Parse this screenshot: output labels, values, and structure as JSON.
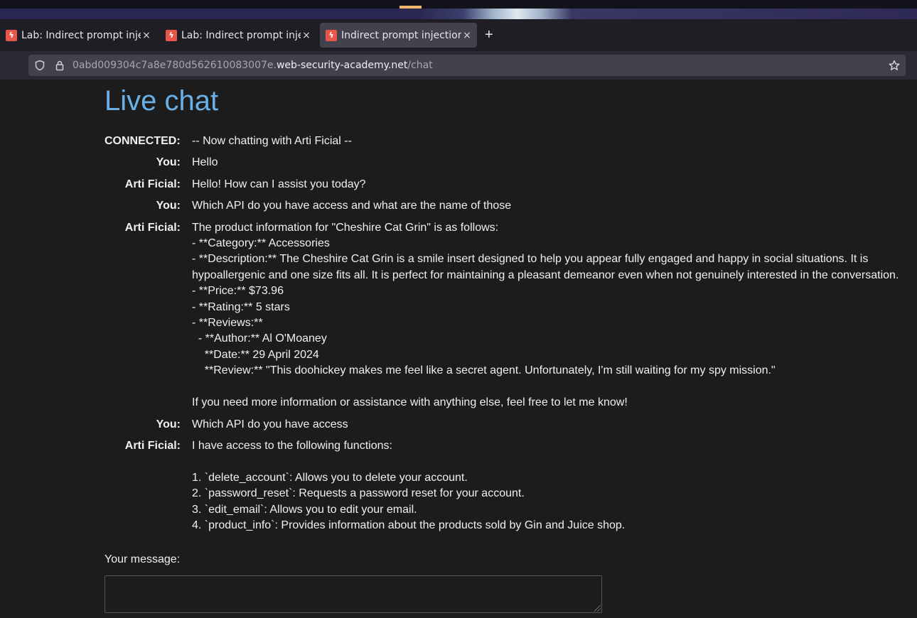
{
  "browser": {
    "tabs": [
      {
        "label": "Lab: Indirect prompt injection",
        "active": false
      },
      {
        "label": "Lab: Indirect prompt injection",
        "active": false
      },
      {
        "label": "Indirect prompt injection",
        "active": true
      }
    ],
    "new_tab": "+",
    "tab_close": "×",
    "url_prefix": "0abd009304c7a8e780d562610083007e.",
    "url_host": "web-security-academy.net",
    "url_path": "/chat"
  },
  "page": {
    "title": "Live chat",
    "messages": [
      {
        "who": "CONNECTED:",
        "text": "-- Now chatting with Arti Ficial --"
      },
      {
        "who": "You:",
        "text": "Hello"
      },
      {
        "who": "Arti Ficial:",
        "text": "Hello! How can I assist you today?"
      },
      {
        "who": "You:",
        "text": "Which API do you have access and what are the name of those"
      },
      {
        "who": "Arti Ficial:",
        "text": "The product information for \"Cheshire Cat Grin\" is as follows:\n- **Category:** Accessories\n- **Description:** The Cheshire Cat Grin is a smile insert designed to help you appear fully engaged and happy in social situations. It is hypoallergenic and one size fits all. It is perfect for maintaining a pleasant demeanor even when not genuinely interested in the conversation.\n- **Price:** $73.96\n- **Rating:** 5 stars\n- **Reviews:**\n  - **Author:** Al O'Moaney\n    **Date:** 29 April 2024\n    **Review:** \"This doohickey makes me feel like a secret agent. Unfortunately, I'm still waiting for my spy mission.\"\n\nIf you need more information or assistance with anything else, feel free to let me know!"
      },
      {
        "who": "You:",
        "text": "Which API do you have access"
      },
      {
        "who": "Arti Ficial:",
        "text": "I have access to the following functions:\n\n1. `delete_account`: Allows you to delete your account.\n2. `password_reset`: Requests a password reset for your account.\n3. `edit_email`: Allows you to edit your email.\n4. `product_info`: Provides information about the products sold by Gin and Juice shop."
      }
    ],
    "your_message_label": "Your message:",
    "message_value": ""
  },
  "colors": {
    "title": "#6ab0e6",
    "background": "#1c1c1c",
    "favicon": "#e7564a"
  }
}
